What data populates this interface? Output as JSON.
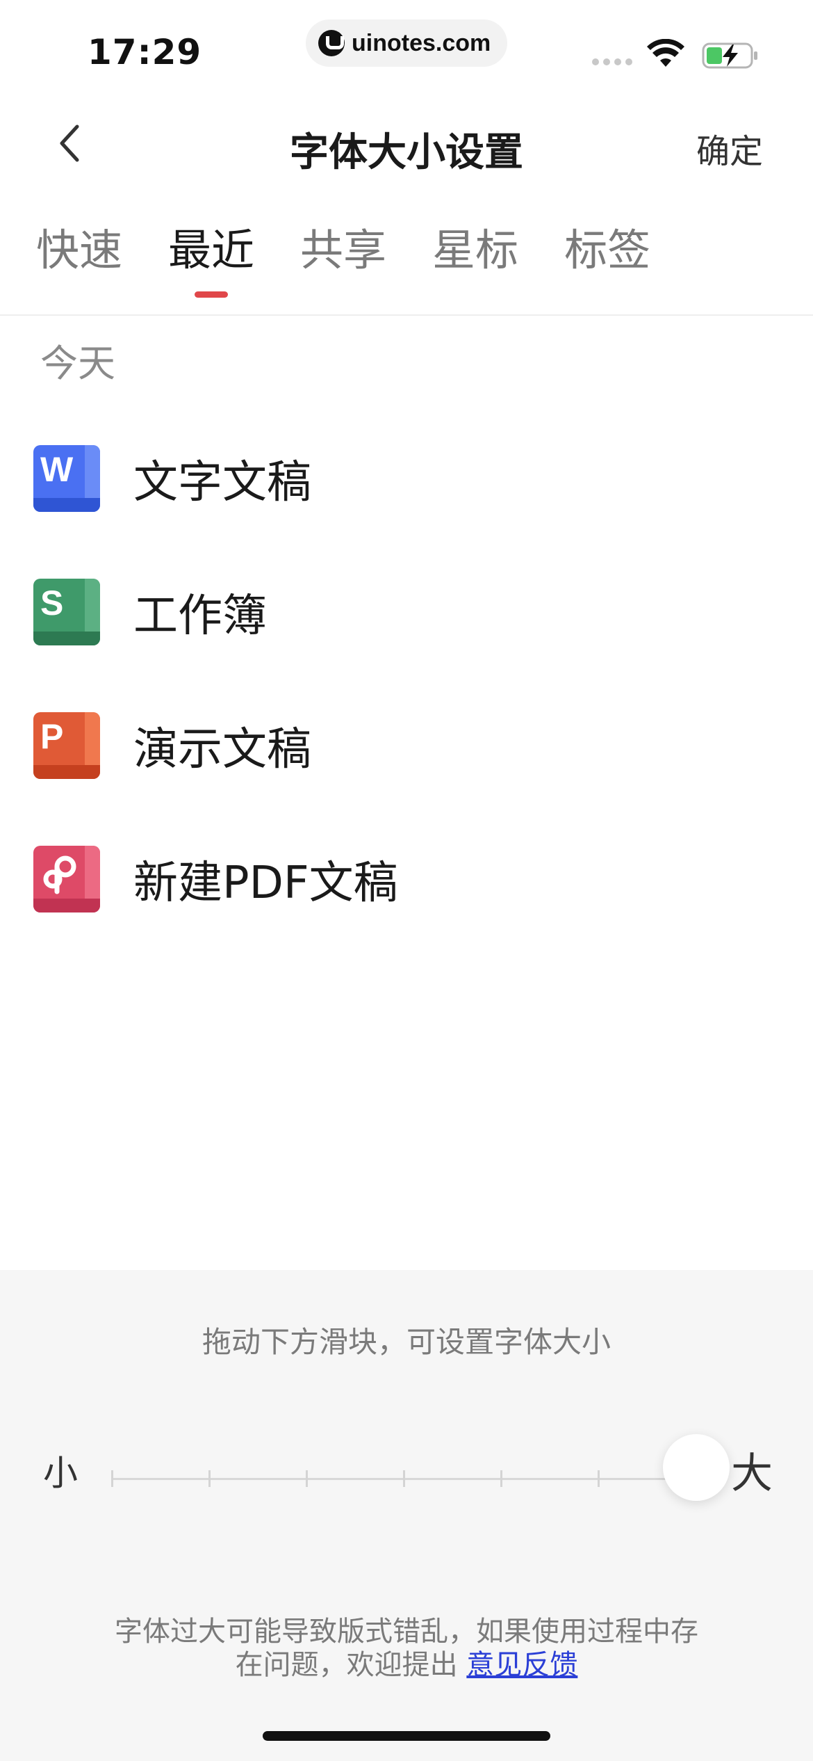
{
  "status_bar": {
    "time": "17:29",
    "url": "uinotes.com",
    "battery_color": "#4cc764"
  },
  "nav": {
    "title": "字体大小设置",
    "confirm_label": "确定"
  },
  "tabs": [
    {
      "label": "快速",
      "active": false
    },
    {
      "label": "最近",
      "active": true
    },
    {
      "label": "共享",
      "active": false
    },
    {
      "label": "星标",
      "active": false
    },
    {
      "label": "标签",
      "active": false
    }
  ],
  "accent_color": "#e0474a",
  "section_header": "今天",
  "documents": [
    {
      "icon": "word-doc-icon",
      "letter": "W",
      "label": "文字文稿"
    },
    {
      "icon": "sheet-doc-icon",
      "letter": "S",
      "label": "工作簿"
    },
    {
      "icon": "presentation-doc-icon",
      "letter": "P",
      "label": "演示文稿"
    },
    {
      "icon": "pdf-doc-icon",
      "letter": "",
      "label": "新建PDF文稿"
    }
  ],
  "font_panel": {
    "hint": "拖动下方滑块，可设置字体大小",
    "small_label": "小",
    "large_label": "大",
    "slider_steps": 7,
    "slider_value_step": 7,
    "warning_line1": "字体过大可能导致版式错乱，如果使用过程中存",
    "warning_line2": "在问题，欢迎提出",
    "feedback_link": "意见反馈"
  }
}
